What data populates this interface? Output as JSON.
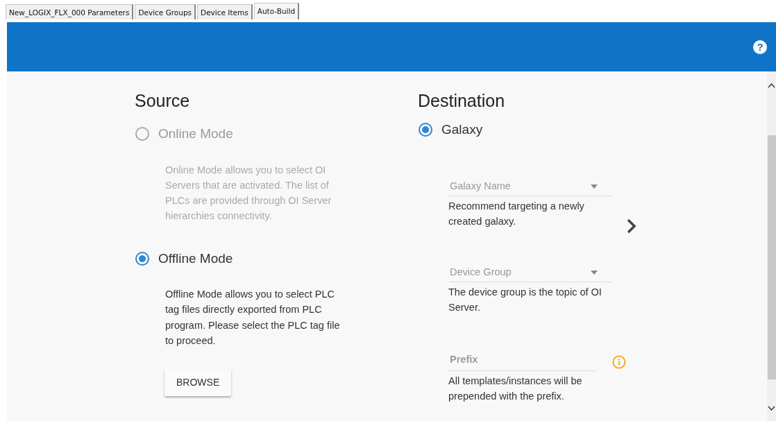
{
  "tabs": [
    {
      "label": "New_LOGIX_FLX_000 Parameters",
      "selected": false
    },
    {
      "label": "Device Groups",
      "selected": false
    },
    {
      "label": "Device Items",
      "selected": false
    },
    {
      "label": "Auto-Build",
      "selected": true
    }
  ],
  "header": {
    "help_icon": "?"
  },
  "source": {
    "title": "Source",
    "options": [
      {
        "label": "Online Mode",
        "selected": false,
        "disabled": true,
        "description": "Online Mode allows you to select OI Servers that are activated. The list of PLCs are provided through OI Server hierarchies connectivity."
      },
      {
        "label": "Offline Mode",
        "selected": true,
        "disabled": false,
        "description": "Offline Mode allows you to select PLC tag files directly exported from PLC program. Please select the PLC tag file to proceed."
      }
    ],
    "browse_button": "BROWSE"
  },
  "destination": {
    "title": "Destination",
    "option": {
      "label": "Galaxy",
      "selected": true
    },
    "fields": [
      {
        "kind": "dropdown",
        "placeholder": "Galaxy Name",
        "helper": "Recommend targeting a newly created galaxy."
      },
      {
        "kind": "dropdown",
        "placeholder": "Device Group",
        "helper": "The device group is the topic of OI Server."
      },
      {
        "kind": "info",
        "placeholder": "Prefix",
        "helper": "All templates/instances will be prepended with the prefix."
      }
    ]
  }
}
